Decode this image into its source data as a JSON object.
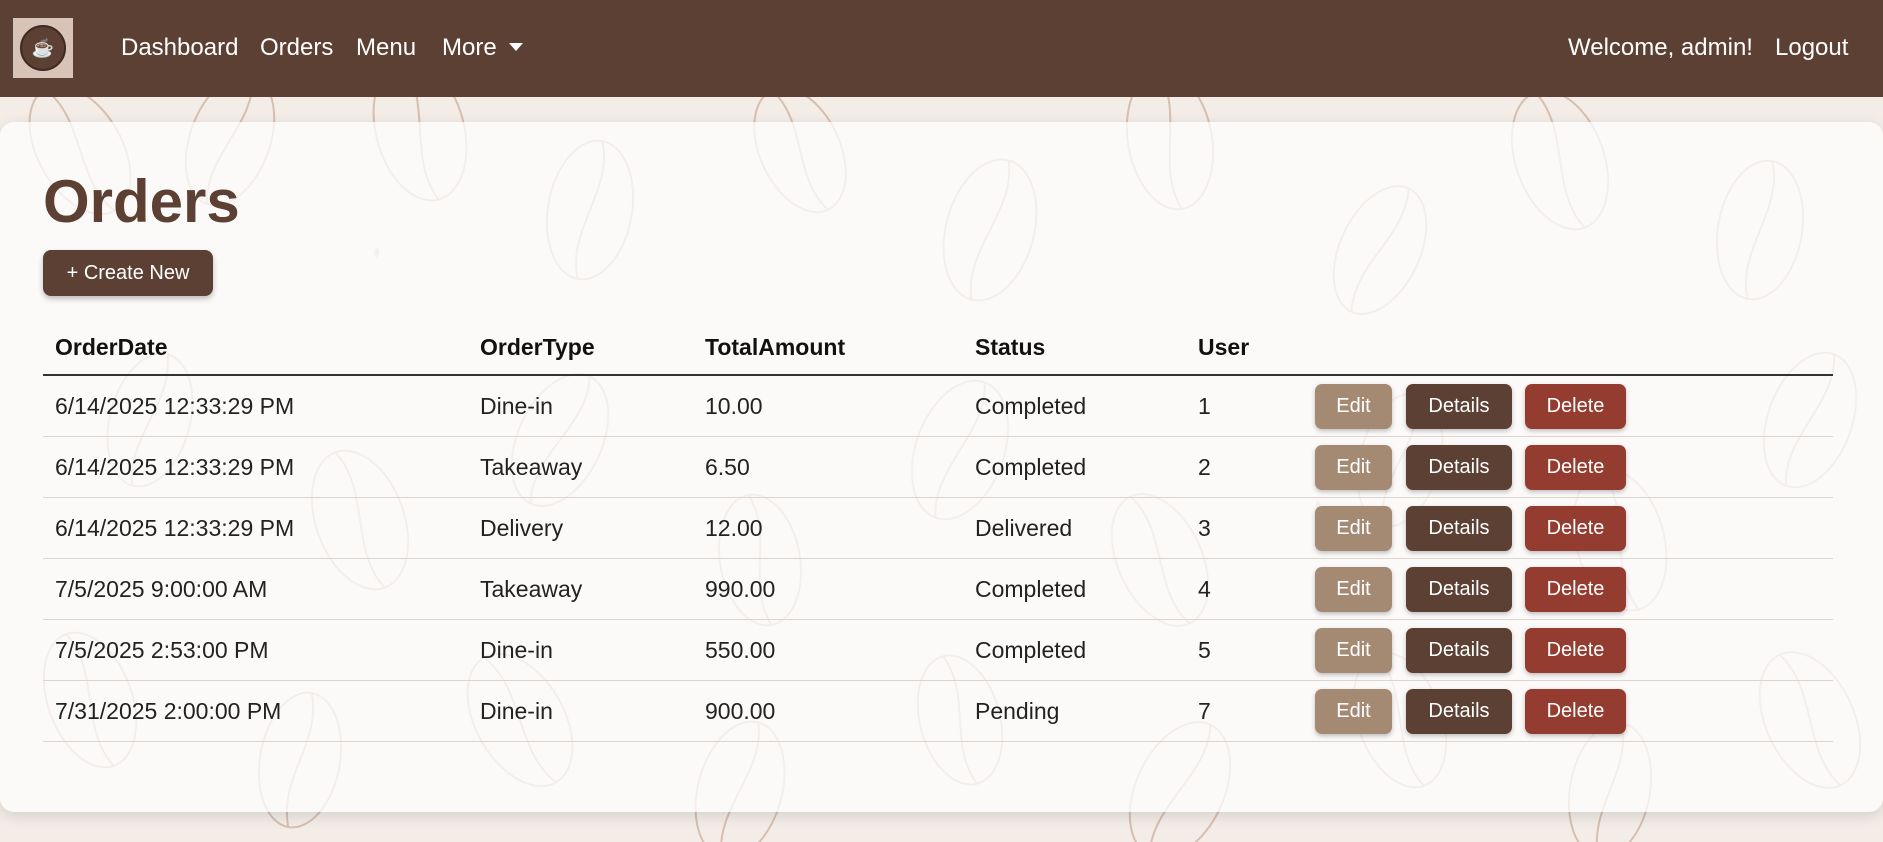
{
  "navbar": {
    "logo_icon": "coffee-cup-icon",
    "links": [
      "Dashboard",
      "Orders",
      "Menu",
      "More"
    ],
    "welcome": "Welcome, admin!",
    "logout": "Logout",
    "background_color": "#5c4033"
  },
  "page": {
    "title": "Orders",
    "create_label": "+ Create New"
  },
  "table": {
    "headers": [
      "OrderDate",
      "OrderType",
      "TotalAmount",
      "Status",
      "User"
    ],
    "rows": [
      {
        "date": "6/14/2025 12:33:29 PM",
        "type": "Dine-in",
        "total": "10.00",
        "status": "Completed",
        "user": "1"
      },
      {
        "date": "6/14/2025 12:33:29 PM",
        "type": "Takeaway",
        "total": "6.50",
        "status": "Completed",
        "user": "2"
      },
      {
        "date": "6/14/2025 12:33:29 PM",
        "type": "Delivery",
        "total": "12.00",
        "status": "Delivered",
        "user": "3"
      },
      {
        "date": "7/5/2025 9:00:00 AM",
        "type": "Takeaway",
        "total": "990.00",
        "status": "Completed",
        "user": "4"
      },
      {
        "date": "7/5/2025 2:53:00 PM",
        "type": "Dine-in",
        "total": "550.00",
        "status": "Completed",
        "user": "5"
      },
      {
        "date": "7/31/2025 2:00:00 PM",
        "type": "Dine-in",
        "total": "900.00",
        "status": "Pending",
        "user": "7"
      }
    ],
    "actions": {
      "edit": "Edit",
      "details": "Details",
      "delete": "Delete"
    }
  },
  "colors": {
    "primary": "#5c4033",
    "edit": "#a58a73",
    "delete": "#943c30"
  }
}
